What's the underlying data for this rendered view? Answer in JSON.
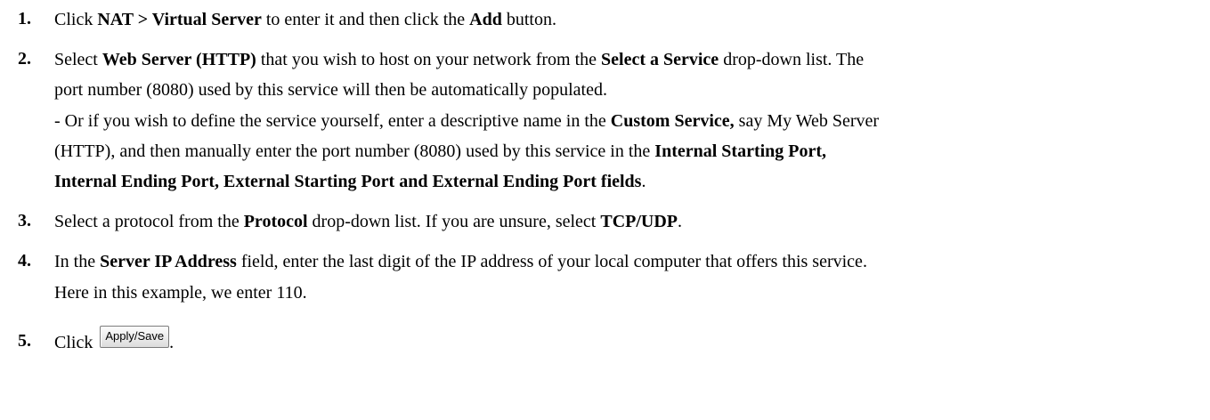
{
  "steps": [
    {
      "number": "1.",
      "lines": [
        [
          {
            "t": "Click ",
            "b": false
          },
          {
            "t": "NAT > Virtual Server",
            "b": true
          },
          {
            "t": " to enter it and then click the ",
            "b": false
          },
          {
            "t": "Add",
            "b": true
          },
          {
            "t": " button.",
            "b": false
          }
        ]
      ]
    },
    {
      "number": "2.",
      "lines": [
        [
          {
            "t": "Select ",
            "b": false
          },
          {
            "t": "Web Server (HTTP)",
            "b": true
          },
          {
            "t": " that you wish to host on your network from the ",
            "b": false
          },
          {
            "t": "Select a Service",
            "b": true
          },
          {
            "t": " drop-down list. The",
            "b": false
          }
        ],
        [
          {
            "t": "port number (8080) used by this service will then be automatically populated.",
            "b": false
          }
        ],
        [
          {
            "t": "- Or if you wish to define the service yourself, enter a descriptive name in the ",
            "b": false
          },
          {
            "t": "Custom Service,",
            "b": true
          },
          {
            "t": " say My Web Server",
            "b": false
          }
        ],
        [
          {
            "t": "(HTTP), and then manually enter the port number (8080) used by this service in the ",
            "b": false
          },
          {
            "t": "Internal Starting Port,",
            "b": true
          }
        ],
        [
          {
            "t": "Internal Ending Port, External Starting Port and External Ending Port fields",
            "b": true
          },
          {
            "t": ".",
            "b": false
          }
        ]
      ]
    },
    {
      "number": "3.",
      "lines": [
        [
          {
            "t": "Select a protocol from the ",
            "b": false
          },
          {
            "t": "Protocol",
            "b": true
          },
          {
            "t": " drop-down list. If you are unsure, select ",
            "b": false
          },
          {
            "t": "TCP/UDP",
            "b": true
          },
          {
            "t": ".",
            "b": false
          }
        ]
      ]
    },
    {
      "number": "4.",
      "lines": [
        [
          {
            "t": "In the ",
            "b": false
          },
          {
            "t": "Server IP Address",
            "b": true
          },
          {
            "t": " field, enter the last digit of the IP address of your local computer that offers this service.",
            "b": false
          }
        ],
        [
          {
            "t": "Here in this example, we enter 110.",
            "b": false
          }
        ]
      ]
    },
    {
      "number": "5.",
      "lines": [
        [
          {
            "t": "Click",
            "b": false
          }
        ]
      ],
      "button_label": "Apply/Save",
      "trailing": "."
    }
  ]
}
